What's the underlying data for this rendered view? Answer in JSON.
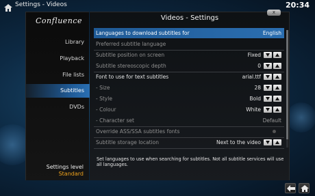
{
  "topbar": {
    "breadcrumb": "Settings - Videos",
    "time": "20:34"
  },
  "sidebar": {
    "logo": "Confluence",
    "items": [
      {
        "label": "Library",
        "active": false
      },
      {
        "label": "Playback",
        "active": false
      },
      {
        "label": "File lists",
        "active": false
      },
      {
        "label": "Subtitles",
        "active": true
      },
      {
        "label": "DVDs",
        "active": false
      }
    ],
    "settings_level_label": "Settings level",
    "settings_level_value": "Standard"
  },
  "panel": {
    "title": "Videos - Settings",
    "close_label": "x",
    "settings": [
      {
        "label": "Languages to download subtitles for",
        "value": "English",
        "selected": true,
        "enabled": true,
        "control": "none"
      },
      {
        "label": "Preferred subtitle language",
        "value": "",
        "selected": false,
        "enabled": false,
        "control": "none"
      },
      {
        "label": "Subtitle position on screen",
        "value": "Fixed",
        "selected": false,
        "enabled": false,
        "control": "spinner"
      },
      {
        "label": "Subtitle stereoscopic depth",
        "value": "0",
        "selected": false,
        "enabled": false,
        "control": "spinner"
      },
      {
        "label": "Font to use for text subtitles",
        "value": "arial.ttf",
        "selected": false,
        "enabled": true,
        "control": "spinner"
      },
      {
        "label": "- Size",
        "value": "28",
        "selected": false,
        "enabled": false,
        "control": "spinner"
      },
      {
        "label": "- Style",
        "value": "Bold",
        "selected": false,
        "enabled": false,
        "control": "spinner"
      },
      {
        "label": "- Colour",
        "value": "White",
        "selected": false,
        "enabled": false,
        "control": "spinner"
      },
      {
        "label": "- Character set",
        "value": "Default",
        "selected": false,
        "enabled": false,
        "control": "none"
      },
      {
        "label": "Override ASS/SSA subtitles fonts",
        "value": "",
        "selected": false,
        "enabled": false,
        "control": "radio"
      },
      {
        "label": "Subtitle storage location",
        "value": "Next to the video",
        "selected": false,
        "enabled": false,
        "control": "spinner"
      }
    ],
    "description": "Set languages to use when searching for subtitles. Not all subtitle services will use all languages."
  },
  "colors": {
    "accent": "#2b6eb0",
    "level_value": "#f2a41c"
  },
  "icons": [
    "home-icon",
    "back-icon",
    "home-button-icon",
    "arrow-up-icon",
    "arrow-down-icon"
  ]
}
